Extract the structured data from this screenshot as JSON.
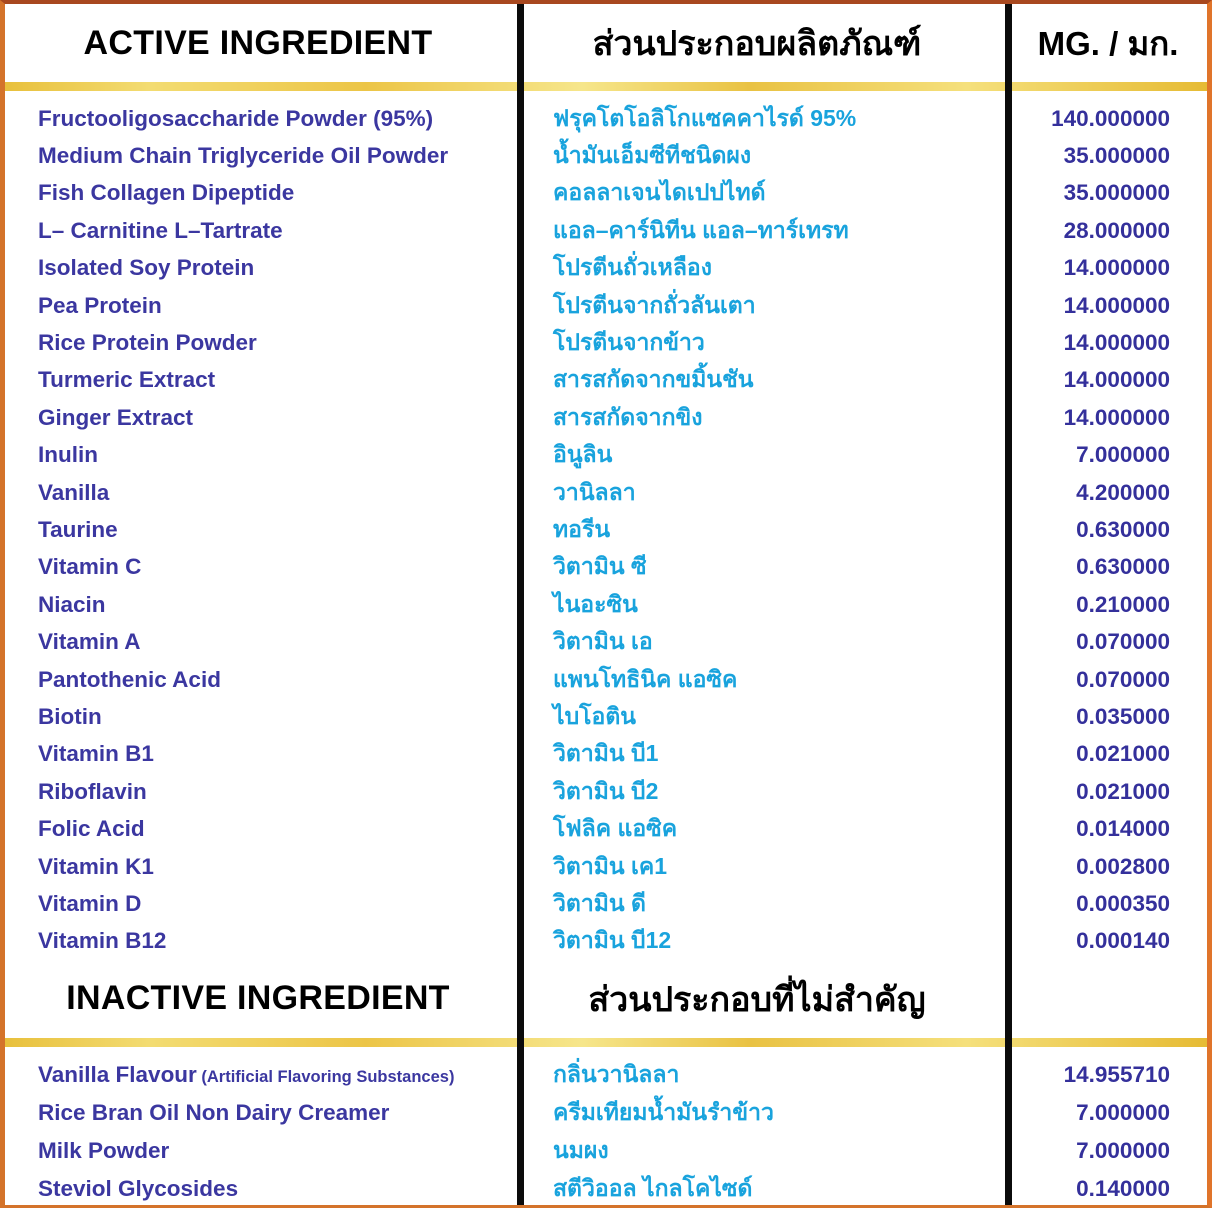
{
  "panel": {
    "accent_border": "#d4732a",
    "divider_gold": "#e8c03c",
    "english_text_color": "#3b37a0",
    "thai_text_color": "#19a3dd",
    "amount_text_color": "#34309b"
  },
  "active_section": {
    "header": {
      "english": "ACTIVE INGREDIENT",
      "thai": "ส่วนประกอบผลิตภัณฑ์",
      "unit": "MG. / มก."
    },
    "rows": [
      {
        "english": "Fructooligosaccharide Powder (95%)",
        "thai": "ฟรุคโตโอลิโกแซคคาไรด์ 95%",
        "mg": "140.000000"
      },
      {
        "english": "Medium Chain  Triglyceride Oil Powder",
        "thai": "น้ำมันเอ็มซีทีชนิดผง",
        "mg": "35.000000"
      },
      {
        "english": "Fish Collagen Dipeptide",
        "thai": "คอลลาเจนไดเปปไทด์",
        "mg": "35.000000"
      },
      {
        "english": "L– Carnitine  L–Tartrate",
        "thai": "แอล–คาร์นิทีน แอล–ทาร์เทรท",
        "mg": "28.000000"
      },
      {
        "english": "Isolated Soy Protein",
        "thai": "โปรตีนถั่วเหลือง",
        "mg": "14.000000"
      },
      {
        "english": "Pea Protein",
        "thai": "โปรตีนจากถั่วลันเตา",
        "mg": "14.000000"
      },
      {
        "english": "Rice Protein Powder",
        "thai": "โปรตีนจากข้าว",
        "mg": "14.000000"
      },
      {
        "english": "Turmeric Extract",
        "thai": "สารสกัดจากขมิ้นชัน",
        "mg": "14.000000"
      },
      {
        "english": "Ginger Extract",
        "thai": "สารสกัดจากขิง",
        "mg": "14.000000"
      },
      {
        "english": "Inulin",
        "thai": "อินูลิน",
        "mg": "7.000000"
      },
      {
        "english": "Vanilla",
        "thai": "วานิลลา",
        "mg": "4.200000"
      },
      {
        "english": "Taurine",
        "thai": "ทอรีน",
        "mg": "0.630000"
      },
      {
        "english": "Vitamin C",
        "thai": "วิตามิน ซี",
        "mg": "0.630000"
      },
      {
        "english": "Niacin",
        "thai": "ไนอะซิน",
        "mg": "0.210000"
      },
      {
        "english": "Vitamin A",
        "thai": "วิตามิน เอ",
        "mg": "0.070000"
      },
      {
        "english": "Pantothenic Acid",
        "thai": "แพนโทธินิค แอซิค",
        "mg": "0.070000"
      },
      {
        "english": "Biotin",
        "thai": "ไบโอติน",
        "mg": "0.035000"
      },
      {
        "english": "Vitamin B1",
        "thai": "วิตามิน บี1",
        "mg": "0.021000"
      },
      {
        "english": "Riboflavin",
        "thai": "วิตามิน บี2",
        "mg": "0.021000"
      },
      {
        "english": "Folic Acid",
        "thai": "โฟลิค แอซิค",
        "mg": "0.014000"
      },
      {
        "english": "Vitamin K1",
        "thai": "วิตามิน เค1",
        "mg": "0.002800"
      },
      {
        "english": "Vitamin D",
        "thai": "วิตามิน ดี",
        "mg": "0.000350"
      },
      {
        "english": "Vitamin B12",
        "thai": "วิตามิน บี12",
        "mg": "0.000140"
      }
    ]
  },
  "inactive_section": {
    "header": {
      "english": "INACTIVE INGREDIENT",
      "thai": "ส่วนประกอบที่ไม่สำคัญ",
      "unit": ""
    },
    "rows": [
      {
        "english": "Vanilla Flavour",
        "english_sub": "(Artificial Flavoring Substances)",
        "thai": "กลิ่นวานิลลา",
        "mg": "14.955710"
      },
      {
        "english": "Rice Bran Oil Non Dairy Creamer",
        "english_sub": "",
        "thai": "ครีมเทียมน้ำมันรำข้าว",
        "mg": "7.000000"
      },
      {
        "english": "Milk Powder",
        "english_sub": "",
        "thai": "นมผง",
        "mg": "7.000000"
      },
      {
        "english": "Steviol Glycosides",
        "english_sub": "",
        "thai": "สตีวิออล ไกลโคไซด์",
        "mg": "0.140000"
      }
    ]
  }
}
